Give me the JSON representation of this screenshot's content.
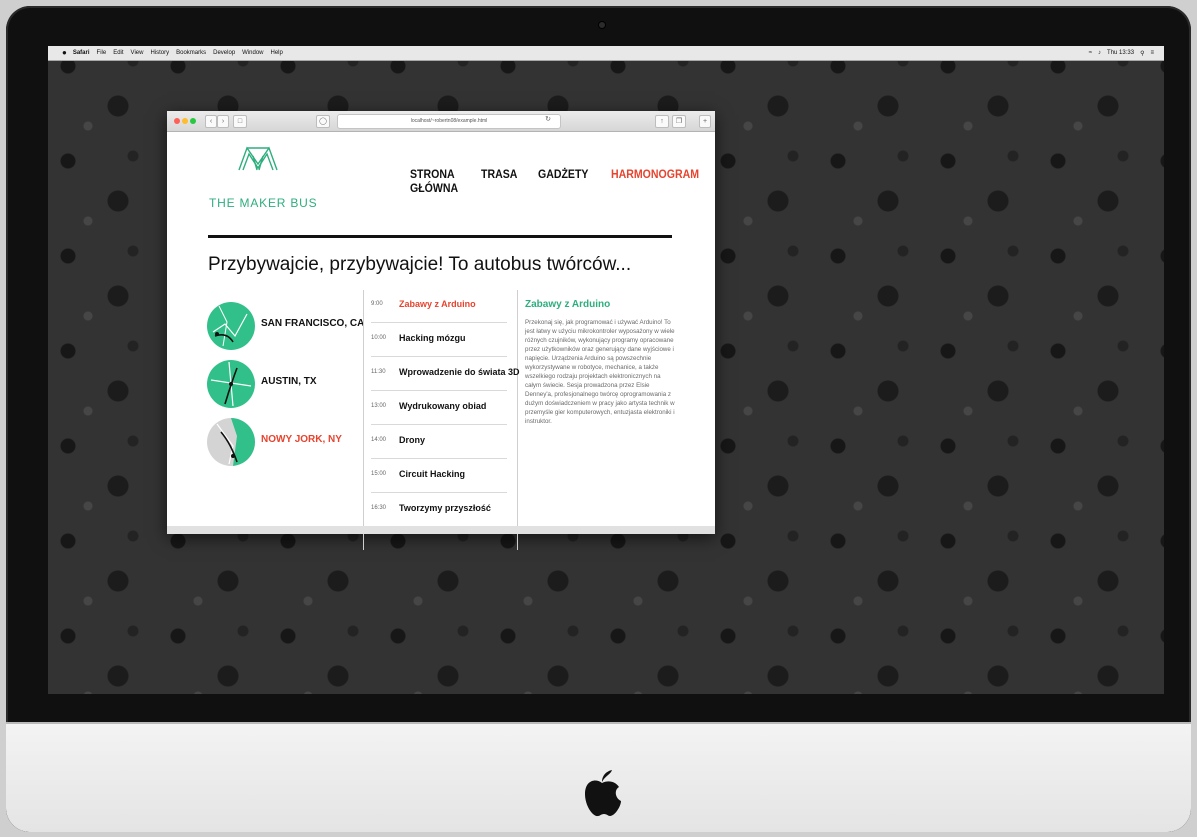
{
  "menubar": {
    "app": "Safari",
    "items": [
      "File",
      "Edit",
      "View",
      "History",
      "Bookmarks",
      "Develop",
      "Window",
      "Help"
    ],
    "clock": "Thu 13:33"
  },
  "browser": {
    "url": "localhost/~robertn08/example.html"
  },
  "site": {
    "logo": "THE MAKER BUS",
    "nav": [
      {
        "label": "STRONA GŁÓWNA",
        "active": false
      },
      {
        "label": "TRASA",
        "active": false
      },
      {
        "label": "GADŻETY",
        "active": false
      },
      {
        "label": "HARMONOGRAM",
        "active": true
      }
    ],
    "headline": "Przybywajcie, przybywajcie! To autobus twórców...",
    "places": [
      {
        "name": "SAN FRANCISCO, CA",
        "active": false
      },
      {
        "name": "AUSTIN, TX",
        "active": false
      },
      {
        "name": "NOWY JORK, NY",
        "active": true
      }
    ],
    "schedule": [
      {
        "time": "9:00",
        "title": "Zabawy z Arduino",
        "active": true
      },
      {
        "time": "10:00",
        "title": "Hacking mózgu",
        "active": false
      },
      {
        "time": "11:30",
        "title": "Wprowadzenie do świata 3D",
        "active": false
      },
      {
        "time": "13:00",
        "title": "Wydrukowany obiad",
        "active": false
      },
      {
        "time": "14:00",
        "title": "Drony",
        "active": false
      },
      {
        "time": "15:00",
        "title": "Circuit Hacking",
        "active": false
      },
      {
        "time": "16:30",
        "title": "Tworzymy przyszłość",
        "active": false
      }
    ],
    "detail": {
      "title": "Zabawy z Arduino",
      "text": "Przekonaj się, jak programować i używać Arduino! To jest łatwy w użyciu mikrokontroler wyposażony w wiele różnych czujników, wykonujący programy opracowane przez użytkowników oraz generujący dane wyjściowe i napięcie. Urządzenia Arduino są powszechnie wykorzystywane w robotyce, mechanice, a także wszelkiego rodzaju projektach elektronicznych na całym świecie. Sesja prowadzona przez Elsie Denney'a, profesjonalnego twórcę oprogramowania z dużym doświadczeniem w pracy jako artysta technik w przemyśle gier komputerowych, entuzjasta elektroniki i instruktor."
    }
  },
  "colors": {
    "accent_green": "#2eae7e",
    "accent_red": "#e7432e",
    "map_green": "#32c08a"
  }
}
